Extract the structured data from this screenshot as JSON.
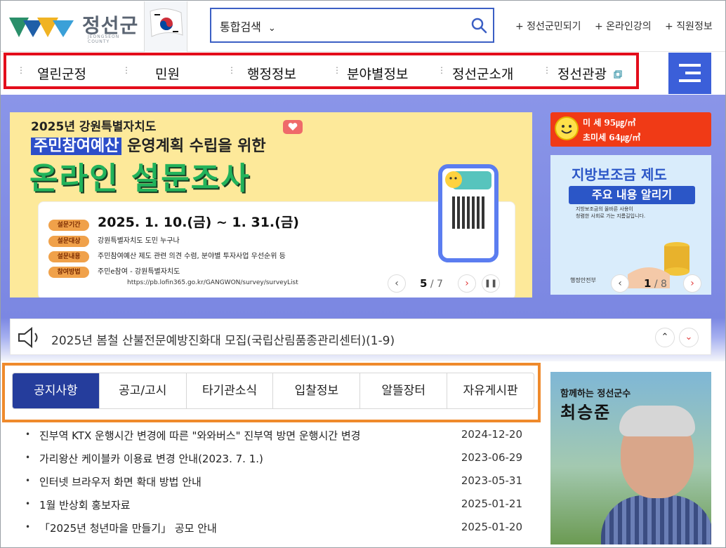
{
  "header": {
    "logo_text": "정선군",
    "logo_sub": "JEONGSEON COUNTY",
    "search": {
      "category": "통합검색",
      "placeholder": ""
    },
    "util_links": [
      "+ 정선군민되기",
      "+ 온라인강의",
      "+ 직원정보"
    ]
  },
  "gnb": {
    "items": [
      "열린군정",
      "민원",
      "행정정보",
      "분야별정보",
      "정선군소개",
      "정선관광"
    ]
  },
  "banner": {
    "top_line": "2025년 강원특별자치도",
    "highlight": "주민참여예산",
    "subtitle_rest": " 운영계획 수립을 위한",
    "title": "온라인 설문조사",
    "rows": [
      {
        "tag": "설문기간",
        "text": "2025. 1. 10.(금) ~ 1. 31.(금)"
      },
      {
        "tag": "설문대상",
        "text": "강원특별자치도 도민 누구나"
      },
      {
        "tag": "설문내용",
        "text": "주민참여예산 제도 관련 의견 수렴, 분야별 투자사업 우선순위 등"
      },
      {
        "tag": "참여방법",
        "text": "주민e참여 - 강원특별자치도"
      }
    ],
    "url": "https://pb.lofin365.go.kr/GANGWON/survey/surveyList",
    "pager_current": "5",
    "pager_total": "/ 7"
  },
  "air": {
    "line1": "미 세 95㎍/㎥",
    "line2": "초미세 64㎍/㎥"
  },
  "side_banner": {
    "title1": "지방보조금 제도",
    "title2": "주요 내용 알리기",
    "desc1": "지방보조금의 올바른 사용이",
    "desc2": "청렴한 사회로 가는 지름길입니다.",
    "footer": "행정안전부",
    "pager_current": "1",
    "pager_total": "/ 8"
  },
  "ticker": {
    "text": "2025년 봄철 산불전문예방진화대 모집(국립산림품종관리센터)(1-9)"
  },
  "board": {
    "tabs": [
      "공지사항",
      "공고/고시",
      "타기관소식",
      "입찰정보",
      "알뜰장터",
      "자유게시판"
    ],
    "items": [
      {
        "title": "진부역 KTX 운행시간 변경에 따른 \"와와버스\" 진부역 방면 운행시간 변경",
        "date": "2024-12-20"
      },
      {
        "title": "가리왕산 케이블카 이용료 변경 안내(2023. 7. 1.)",
        "date": "2023-06-29"
      },
      {
        "title": "인터넷 브라우저 화면 확대 방법 안내",
        "date": "2023-05-31"
      },
      {
        "title": "1월 반상회 홍보자료",
        "date": "2025-01-21"
      },
      {
        "title": "「2025년 청년마을 만들기」 공모 안내",
        "date": "2025-01-20"
      }
    ]
  },
  "mayor": {
    "subtitle": "함께하는 정선군수",
    "name": "최승준"
  },
  "colors": {
    "accent_blue": "#253d9c",
    "gnb_highlight": "#e30d1b",
    "board_highlight": "#ef8a2c",
    "air_bad": "#f03a16"
  }
}
